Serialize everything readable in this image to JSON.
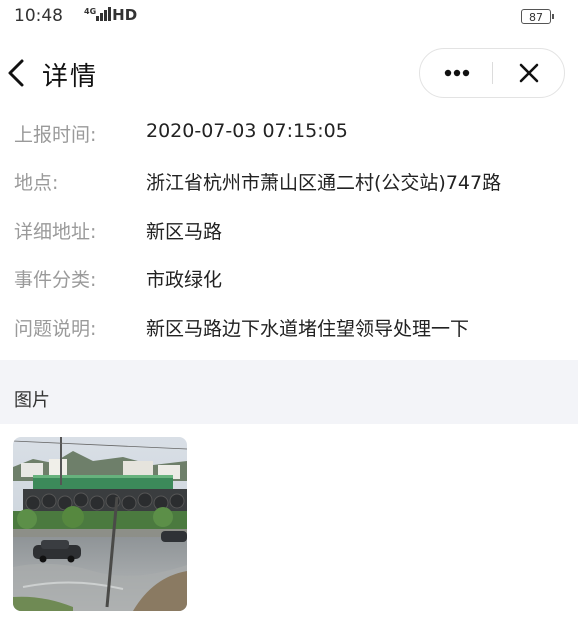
{
  "status_bar": {
    "time": "10:48",
    "network": "4G",
    "hd": "HD",
    "battery": "87"
  },
  "nav": {
    "title": "详情",
    "icons": [
      "back-icon",
      "more-icon",
      "close-icon"
    ]
  },
  "details": [
    {
      "label": "上报时间:",
      "value": "2020-07-03 07:15:05"
    },
    {
      "label": "地点:",
      "value": "浙江省杭州市萧山区通二村(公交站)747路"
    },
    {
      "label": "详细地址:",
      "value": "新区马路"
    },
    {
      "label": "事件分类:",
      "value": "市政绿化"
    },
    {
      "label": "问题说明:",
      "value": "新区马路边下水道堵住望领导处理一下"
    }
  ],
  "photos_section": {
    "title": "图片"
  },
  "colors": {
    "label": "#9a9a9a",
    "value": "#222222",
    "section_bg": "#f3f4f8"
  }
}
